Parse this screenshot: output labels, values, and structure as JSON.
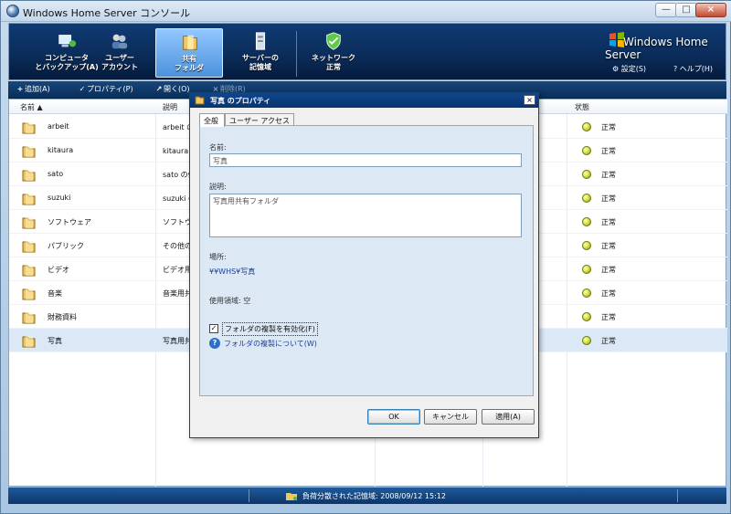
{
  "window": {
    "title": "Windows Home Server コンソール",
    "minimize": "—",
    "maximize": "□",
    "close": "×"
  },
  "header": {
    "nav": [
      {
        "label_line1": "コンピュータ",
        "label_line2": "とバックアップ(A)",
        "icon": "computer-backup-icon"
      },
      {
        "label_line1": "ユーザー",
        "label_line2": "アカウント",
        "icon": "user-accounts-icon"
      },
      {
        "label_line1": "共有",
        "label_line2": "フォルダ",
        "icon": "shared-folder-icon"
      },
      {
        "label_line1": "サーバーの",
        "label_line2": "記憶域",
        "icon": "server-storage-icon"
      },
      {
        "label_line1": "ネットワーク",
        "label_line2": "正常",
        "icon": "network-shield-icon"
      }
    ],
    "brand": "Windows Home Server",
    "settings": "設定(S)",
    "help": "ヘルプ(H)"
  },
  "toolbar": {
    "add": "追加(A)",
    "properties": "プロパティ(P)",
    "open": "開く(O)",
    "delete": "削除(R)"
  },
  "columns": {
    "name": "名前",
    "sort_indicator": "▲",
    "description": "説明",
    "status": "状態"
  },
  "folders": [
    {
      "name": "arbeit",
      "desc": "arbeit の",
      "status": "正常"
    },
    {
      "name": "kitaura",
      "desc": "kitaura の",
      "status": "正常"
    },
    {
      "name": "sato",
      "desc": "sato の個",
      "status": "正常"
    },
    {
      "name": "suzuki",
      "desc": "suzuki の",
      "status": "正常"
    },
    {
      "name": "ソフトウェア",
      "desc": "ソフトウェア",
      "status": "正常"
    },
    {
      "name": "パブリック",
      "desc": "その他の",
      "status": "正常"
    },
    {
      "name": "ビデオ",
      "desc": "ビデオ用共",
      "status": "正常"
    },
    {
      "name": "音楽",
      "desc": "音楽用共",
      "status": "正常"
    },
    {
      "name": "財務資料",
      "desc": "",
      "status": "正常"
    },
    {
      "name": "写真",
      "desc": "写真用共",
      "status": "正常"
    }
  ],
  "statusbar": {
    "text": "負荷分散された記憶域: 2008/09/12 15:12"
  },
  "dialog": {
    "title": "写真 のプロパティ",
    "close": "×",
    "tabs": {
      "general": "全般",
      "user_access": "ユーザー アクセス"
    },
    "name_label": "名前:",
    "name_value": "写真",
    "description_label": "説明:",
    "description_value": "写真用共有フォルダ",
    "location_label": "場所:",
    "location_value": "¥¥WHS¥写真",
    "usage": "使用領域: 空",
    "duplicate_checked": "✓",
    "duplicate_label": "フォルダの複製を有効化(F)",
    "about_duplicate": "フォルダの複製について(W)",
    "help_glyph": "?",
    "buttons": {
      "ok": "OK",
      "cancel": "キャンセル",
      "apply": "適用(A)"
    }
  }
}
